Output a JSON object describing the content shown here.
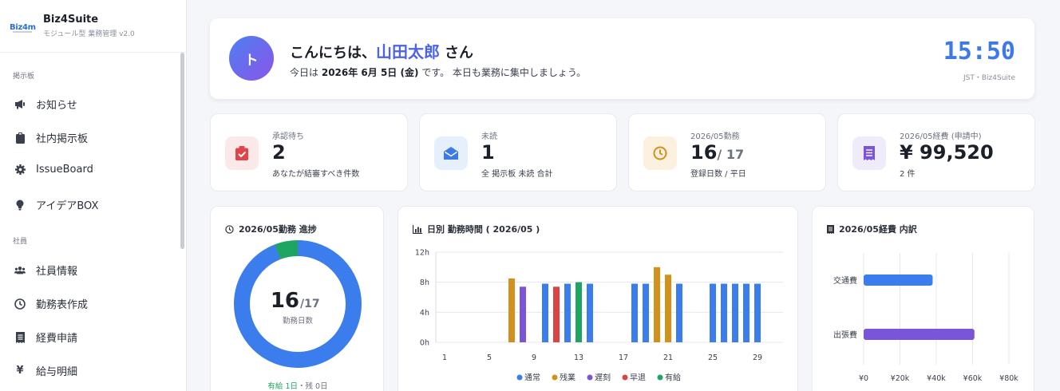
{
  "brand": {
    "logo_text": "Biz4m",
    "name": "Biz4Suite",
    "subtitle": "モジュール型 業務管理 v2.0"
  },
  "sidebar": {
    "sections": [
      {
        "label": "掲示板",
        "items": [
          {
            "label": "お知らせ",
            "icon": "megaphone-icon"
          },
          {
            "label": "社内掲示板",
            "icon": "clipboard-icon"
          },
          {
            "label": "IssueBoard",
            "icon": "gear-icon"
          },
          {
            "label": "アイデアBOX",
            "icon": "lightbulb-icon"
          }
        ]
      },
      {
        "label": "社員",
        "items": [
          {
            "label": "社員情報",
            "icon": "users-icon"
          },
          {
            "label": "勤務表作成",
            "icon": "clock-icon"
          },
          {
            "label": "経費申請",
            "icon": "receipt-icon"
          },
          {
            "label": "給与明細",
            "icon": "yen-icon"
          }
        ]
      }
    ]
  },
  "welcome": {
    "avatar": "ト",
    "greeting_prefix": "こんにちは、",
    "user_name": "山田太郎",
    "greeting_suffix": "さん",
    "today_prefix": "今日は",
    "today_date": "2026年 6月 5日 (金)",
    "today_suffix": "です。 本日も業務に集中しましょう。",
    "clock": "15:50",
    "clock_sub": "JST・Biz4Suite"
  },
  "stats": [
    {
      "label": "承認待ち",
      "value": "2",
      "sub": "あなたが結審すべき件数",
      "icon": "clipboard-check-icon",
      "color": "#e0454a",
      "bg": "#fbe9ea"
    },
    {
      "label": "未読",
      "value": "1",
      "sub": "全 掲示板 未読 合計",
      "icon": "envelope-open-icon",
      "color": "#3d7ae8",
      "bg": "#e6effc"
    },
    {
      "label": "2026/05勤務",
      "value": "16",
      "value_den": "/ 17",
      "sub": "登録日数 / 平日",
      "icon": "clock-icon",
      "color": "#d2901c",
      "bg": "#fbf1de"
    },
    {
      "label": "2026/05経費 (申請中)",
      "value": "¥ 99,520",
      "sub": "2 件",
      "icon": "receipt-icon",
      "color": "#7a55d8",
      "bg": "#efebfb"
    }
  ],
  "progress": {
    "title": "2026/05勤務 進捗",
    "center_value": "16",
    "center_den": "/17",
    "center_label": "勤務日数",
    "worked_days": 16,
    "total_days": 17,
    "footer_paid": "有給 1日",
    "footer_rest": "・残 0日",
    "colors": {
      "main": "#3b7ded",
      "paid": "#1fa562"
    }
  },
  "chart_data": [
    {
      "type": "bar",
      "title": "日別 勤務時間 ( 2026/05 )",
      "ylim": [
        0,
        12
      ],
      "yticks": [
        "0h",
        "4h",
        "8h",
        "12h"
      ],
      "xticks": [
        "1",
        "5",
        "9",
        "13",
        "17",
        "21",
        "25",
        "29"
      ],
      "x": [
        7,
        8,
        10,
        11,
        12,
        13,
        14,
        18,
        19,
        20,
        21,
        22,
        25,
        26,
        27,
        28,
        29
      ],
      "values": [
        8.5,
        7.4,
        7.8,
        7.4,
        7.8,
        8.0,
        7.8,
        7.8,
        7.8,
        10.0,
        9.0,
        7.8,
        7.8,
        7.8,
        7.8,
        7.8,
        7.8
      ],
      "kinds": [
        "残業",
        "遅刻",
        "通常",
        "早退",
        "通常",
        "有給",
        "通常",
        "通常",
        "通常",
        "残業",
        "残業",
        "通常",
        "通常",
        "通常",
        "通常",
        "通常",
        "通常"
      ],
      "legend": [
        {
          "name": "通常",
          "color": "#3b7ded"
        },
        {
          "name": "残業",
          "color": "#d2901c"
        },
        {
          "name": "遅刻",
          "color": "#7a55d8"
        },
        {
          "name": "早退",
          "color": "#d94545"
        },
        {
          "name": "有給",
          "color": "#1fa562"
        }
      ]
    },
    {
      "type": "bar",
      "orientation": "horizontal",
      "title": "2026/05経費 内訳",
      "categories": [
        "交通費",
        "出張費"
      ],
      "values": [
        38000,
        61000
      ],
      "colors": [
        "#3b7ded",
        "#7a55d8"
      ],
      "xlim": [
        0,
        80000
      ],
      "xticks": [
        "¥0",
        "¥20k",
        "¥40k",
        "¥60k",
        "¥80k"
      ]
    }
  ]
}
